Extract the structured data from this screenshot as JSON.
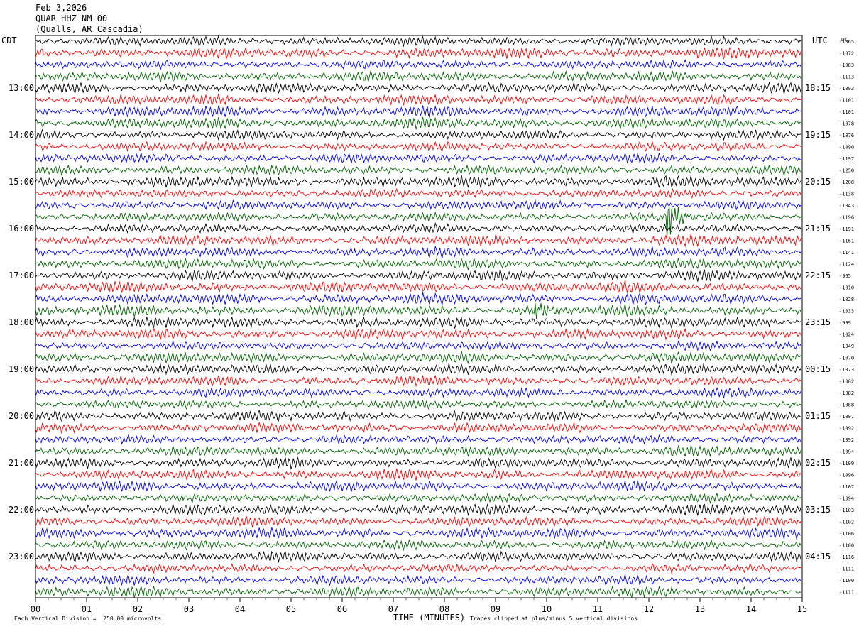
{
  "header": {
    "date": "Feb 3,2026",
    "station": "QUAR HHZ NM 00",
    "location": "(Qualls, AR Cascadia)"
  },
  "chart_data": {
    "type": "line",
    "title": "QUAR HHZ NM 00",
    "xlabel": "TIME (MINUTES)",
    "left_axis_label": "CDT",
    "right_axis_label": "UTC",
    "right_column_label": "DC",
    "xlim": [
      0,
      15
    ],
    "x_ticks": [
      "00",
      "01",
      "02",
      "03",
      "04",
      "05",
      "06",
      "07",
      "08",
      "09",
      "10",
      "11",
      "12",
      "13",
      "14",
      "15"
    ],
    "left_hour_labels": [
      "13:00",
      "14:00",
      "15:00",
      "16:00",
      "17:00",
      "18:00",
      "19:00",
      "20:00",
      "21:00",
      "22:00",
      "23:00"
    ],
    "right_hour_labels": [
      "18:15",
      "19:15",
      "20:15",
      "21:15",
      "22:15",
      "23:15",
      "00:15",
      "01:15",
      "02:15",
      "03:15",
      "04:15"
    ],
    "trace_colors": [
      "#000000",
      "#ff0000",
      "#0000ff",
      "#006400"
    ],
    "dc_offsets": [
      "-1065",
      "-1072",
      "-1083",
      "-1113",
      "-1093",
      "-1101",
      "-1101",
      "-1078",
      "-1076",
      "-1090",
      "-1197",
      "-1250",
      "-1208",
      "-1138",
      "-1043",
      "-1196",
      "-1191",
      "-1161",
      "-1141",
      "-1124",
      "-965",
      "-1010",
      "-1028",
      "-1033",
      "-999",
      "-1024",
      "-1049",
      "-1070",
      "-1073",
      "-1082",
      "-1082",
      "-1088",
      "-1097",
      "-1092",
      "-1092",
      "-1094",
      "-1109",
      "-1096",
      "-1107",
      "-1094",
      "-1103",
      "-1102",
      "-1106",
      "-1100",
      "-1116",
      "-1111",
      "-1100",
      "-1111"
    ],
    "events": [
      {
        "trace": 15,
        "minute": 12.4,
        "label": ""
      },
      {
        "trace": 23,
        "minute": 9.8,
        "label": ""
      }
    ],
    "vertical_scale": "Each Vertical Division =  250.00 microvolts",
    "clip_note": "Traces clipped at plus/minus 5 vertical divisions"
  }
}
